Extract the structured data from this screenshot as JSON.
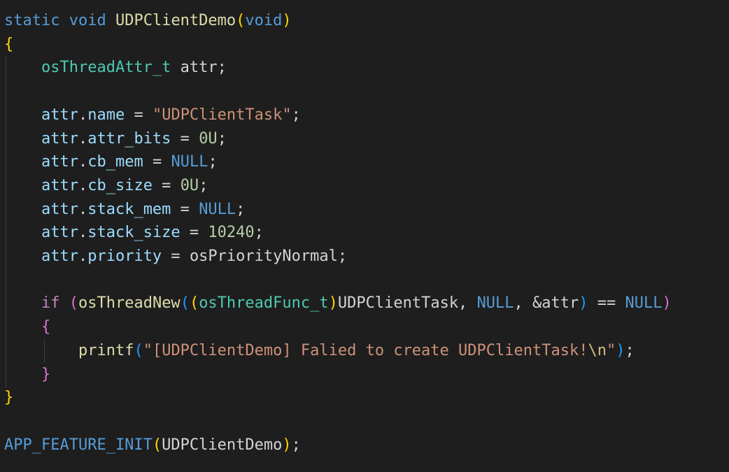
{
  "code": {
    "lines": [
      [
        [
          "kw",
          "static"
        ],
        [
          "plain",
          " "
        ],
        [
          "kw",
          "void"
        ],
        [
          "plain",
          " "
        ],
        [
          "fn",
          "UDPClientDemo"
        ],
        [
          "br1",
          "("
        ],
        [
          "kw",
          "void"
        ],
        [
          "br1",
          ")"
        ]
      ],
      [
        [
          "br1",
          "{"
        ]
      ],
      [
        [
          "plain",
          "    "
        ],
        [
          "type",
          "osThreadAttr_t"
        ],
        [
          "plain",
          " attr;"
        ]
      ],
      [],
      [
        [
          "plain",
          "    "
        ],
        [
          "var",
          "attr"
        ],
        [
          "plain",
          "."
        ],
        [
          "var",
          "name"
        ],
        [
          "plain",
          " = "
        ],
        [
          "str",
          "\"UDPClientTask\""
        ],
        [
          "plain",
          ";"
        ]
      ],
      [
        [
          "plain",
          "    "
        ],
        [
          "var",
          "attr"
        ],
        [
          "plain",
          "."
        ],
        [
          "var",
          "attr_bits"
        ],
        [
          "plain",
          " = "
        ],
        [
          "num",
          "0U"
        ],
        [
          "plain",
          ";"
        ]
      ],
      [
        [
          "plain",
          "    "
        ],
        [
          "var",
          "attr"
        ],
        [
          "plain",
          "."
        ],
        [
          "var",
          "cb_mem"
        ],
        [
          "plain",
          " = "
        ],
        [
          "macro",
          "NULL"
        ],
        [
          "plain",
          ";"
        ]
      ],
      [
        [
          "plain",
          "    "
        ],
        [
          "var",
          "attr"
        ],
        [
          "plain",
          "."
        ],
        [
          "var",
          "cb_size"
        ],
        [
          "plain",
          " = "
        ],
        [
          "num",
          "0U"
        ],
        [
          "plain",
          ";"
        ]
      ],
      [
        [
          "plain",
          "    "
        ],
        [
          "var",
          "attr"
        ],
        [
          "plain",
          "."
        ],
        [
          "var",
          "stack_mem"
        ],
        [
          "plain",
          " = "
        ],
        [
          "macro",
          "NULL"
        ],
        [
          "plain",
          ";"
        ]
      ],
      [
        [
          "plain",
          "    "
        ],
        [
          "var",
          "attr"
        ],
        [
          "plain",
          "."
        ],
        [
          "var",
          "stack_size"
        ],
        [
          "plain",
          " = "
        ],
        [
          "num",
          "10240"
        ],
        [
          "plain",
          ";"
        ]
      ],
      [
        [
          "plain",
          "    "
        ],
        [
          "var",
          "attr"
        ],
        [
          "plain",
          "."
        ],
        [
          "var",
          "priority"
        ],
        [
          "plain",
          " = "
        ],
        [
          "plain",
          "osPriorityNormal;"
        ]
      ],
      [],
      [
        [
          "plain",
          "    "
        ],
        [
          "ctl",
          "if"
        ],
        [
          "plain",
          " "
        ],
        [
          "br2",
          "("
        ],
        [
          "fn",
          "osThreadNew"
        ],
        [
          "br3",
          "("
        ],
        [
          "br1",
          "("
        ],
        [
          "type",
          "osThreadFunc_t"
        ],
        [
          "br1",
          ")"
        ],
        [
          "plain",
          "UDPClientTask, "
        ],
        [
          "macro",
          "NULL"
        ],
        [
          "plain",
          ", &attr"
        ],
        [
          "br3",
          ")"
        ],
        [
          "plain",
          " == "
        ],
        [
          "macro",
          "NULL"
        ],
        [
          "br2",
          ")"
        ]
      ],
      [
        [
          "plain",
          "    "
        ],
        [
          "br2",
          "{"
        ]
      ],
      [
        [
          "plain",
          "        "
        ],
        [
          "fn",
          "printf"
        ],
        [
          "br3",
          "("
        ],
        [
          "str",
          "\"[UDPClientDemo] Falied to create UDPClientTask!"
        ],
        [
          "esc",
          "\\n"
        ],
        [
          "str",
          "\""
        ],
        [
          "br3",
          ")"
        ],
        [
          "plain",
          ";"
        ]
      ],
      [
        [
          "plain",
          "    "
        ],
        [
          "br2",
          "}"
        ]
      ],
      [
        [
          "br1",
          "}"
        ]
      ],
      [],
      [
        [
          "macro",
          "APP_FEATURE_INIT"
        ],
        [
          "br1",
          "("
        ],
        [
          "plain",
          "UDPClientDemo"
        ],
        [
          "br1",
          ")"
        ],
        [
          "plain",
          ";"
        ]
      ]
    ]
  }
}
